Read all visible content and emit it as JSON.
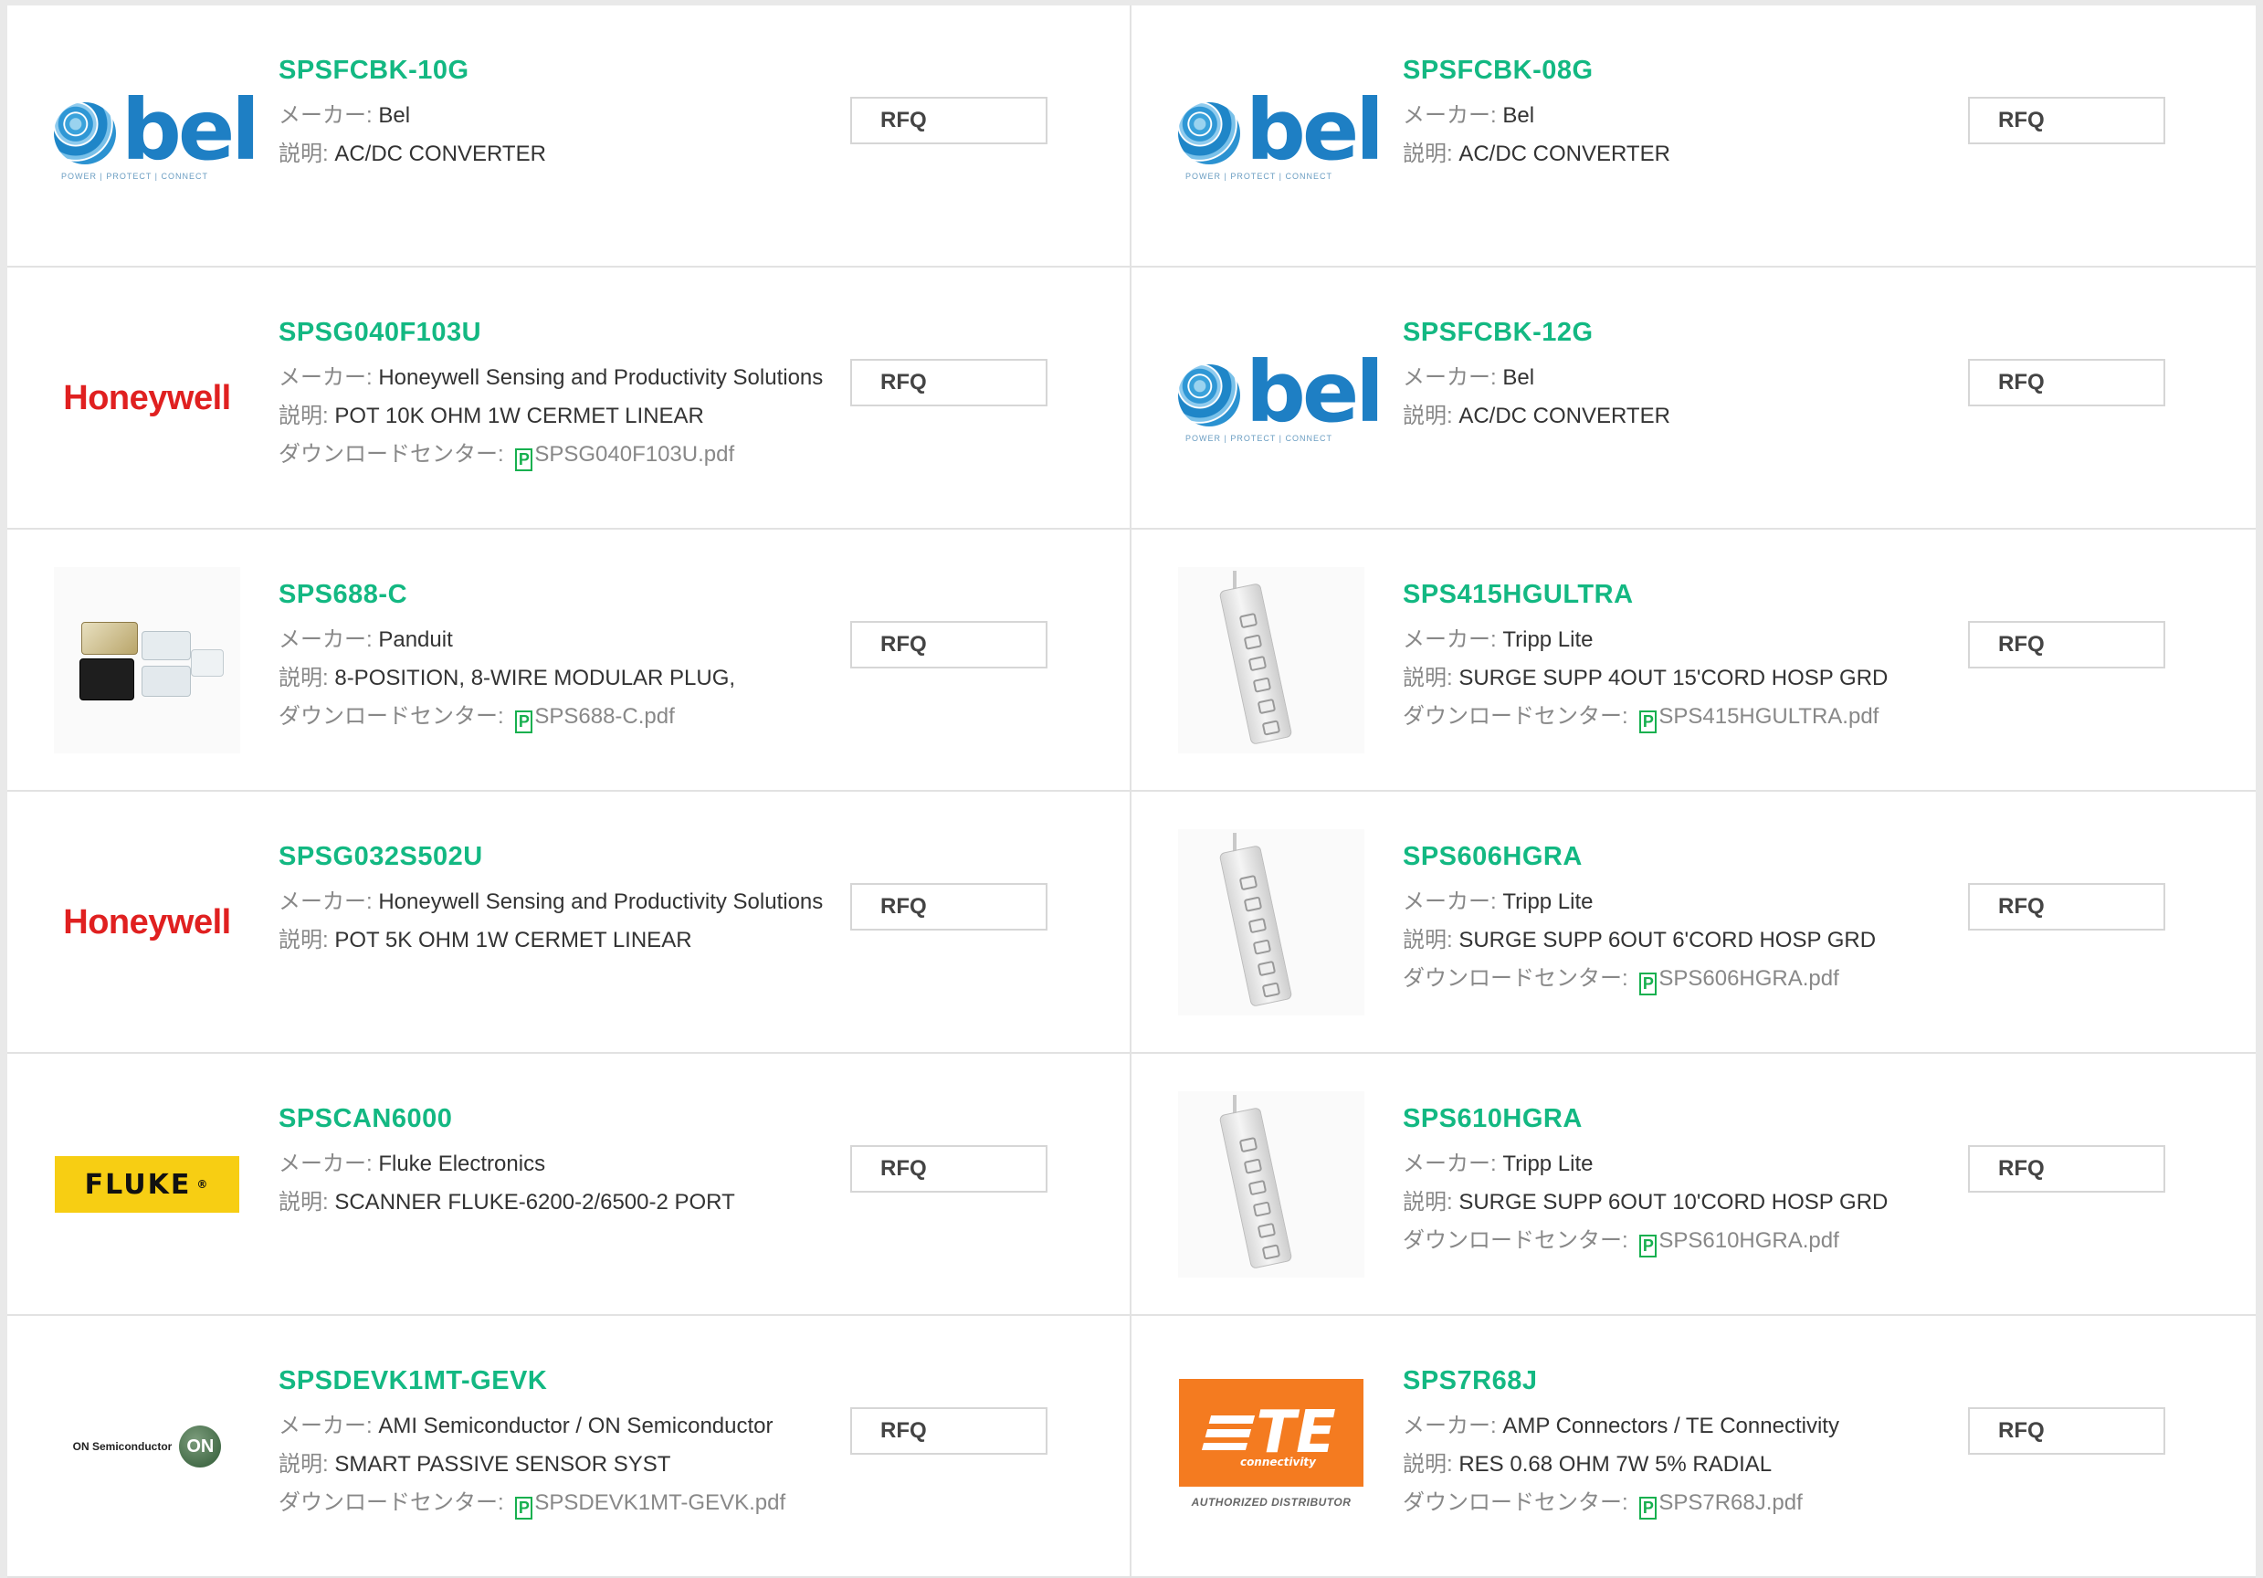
{
  "labels": {
    "maker": "メーカー: ",
    "desc": "説明: ",
    "download": "ダウンロードセンター: "
  },
  "pdf_icon_glyph": "P",
  "colors": {
    "part_number": "#13b882",
    "pdf_icon": "#17b04f",
    "honeywell": "#e02020",
    "fluke": "#f7ce13",
    "te": "#f47b20",
    "bel": "#1e7fc4"
  },
  "logos": {
    "bel_word": "bel",
    "bel_tagline": "POWER | PROTECT | CONNECT",
    "honeywell": "Honeywell",
    "fluke": "FLUKE",
    "fluke_mark": "®",
    "onsemi_text": "ON Semiconductor",
    "onsemi_mark": "ON",
    "te_word": "TE",
    "te_conn": "connectivity",
    "te_dist": "AUTHORIZED DISTRIBUTOR"
  },
  "products": [
    {
      "part": "SPSFCBK-10G",
      "maker": "Bel",
      "desc": "AC/DC CONVERTER",
      "pdf": "",
      "rfq": "RFQ",
      "logo": "bel"
    },
    {
      "part": "SPSFCBK-08G",
      "maker": "Bel",
      "desc": "AC/DC CONVERTER",
      "pdf": "",
      "rfq": "RFQ",
      "logo": "bel"
    },
    {
      "part": "SPSG040F103U",
      "maker": "Honeywell Sensing and Productivity Solutions",
      "desc": "POT 10K OHM 1W CERMET LINEAR",
      "pdf": "SPSG040F103U.pdf",
      "rfq": "RFQ",
      "logo": "honeywell"
    },
    {
      "part": "SPSFCBK-12G",
      "maker": "Bel",
      "desc": "AC/DC CONVERTER",
      "pdf": "",
      "rfq": "RFQ",
      "logo": "bel"
    },
    {
      "part": "SPS688-C",
      "maker": "Panduit",
      "desc": "8-POSITION, 8-WIRE MODULAR PLUG,",
      "pdf": "SPS688-C.pdf",
      "rfq": "RFQ",
      "logo": "plug-photo"
    },
    {
      "part": "SPS415HGULTRA",
      "maker": "Tripp Lite",
      "desc": "SURGE SUPP 4OUT 15'CORD HOSP GRD",
      "pdf": "SPS415HGULTRA.pdf",
      "rfq": "RFQ",
      "logo": "strip-photo"
    },
    {
      "part": "SPSG032S502U",
      "maker": "Honeywell Sensing and Productivity Solutions",
      "desc": "POT 5K OHM 1W CERMET LINEAR",
      "pdf": "",
      "rfq": "RFQ",
      "logo": "honeywell"
    },
    {
      "part": "SPS606HGRA",
      "maker": "Tripp Lite",
      "desc": "SURGE SUPP 6OUT 6'CORD HOSP GRD",
      "pdf": "SPS606HGRA.pdf",
      "rfq": "RFQ",
      "logo": "strip-photo"
    },
    {
      "part": "SPSCAN6000",
      "maker": "Fluke Electronics",
      "desc": "SCANNER FLUKE-6200-2/6500-2 PORT",
      "pdf": "",
      "rfq": "RFQ",
      "logo": "fluke"
    },
    {
      "part": "SPS610HGRA",
      "maker": "Tripp Lite",
      "desc": "SURGE SUPP 6OUT 10'CORD HOSP GRD",
      "pdf": "SPS610HGRA.pdf",
      "rfq": "RFQ",
      "logo": "strip-photo"
    },
    {
      "part": "SPSDEVK1MT-GEVK",
      "maker": "AMI Semiconductor / ON Semiconductor",
      "desc": "SMART PASSIVE SENSOR SYST",
      "pdf": "SPSDEVK1MT-GEVK.pdf",
      "rfq": "RFQ",
      "logo": "onsemi"
    },
    {
      "part": "SPS7R68J",
      "maker": "AMP Connectors / TE Connectivity",
      "desc": "RES 0.68 OHM 7W 5% RADIAL",
      "pdf": "SPS7R68J.pdf",
      "rfq": "RFQ",
      "logo": "te"
    }
  ]
}
